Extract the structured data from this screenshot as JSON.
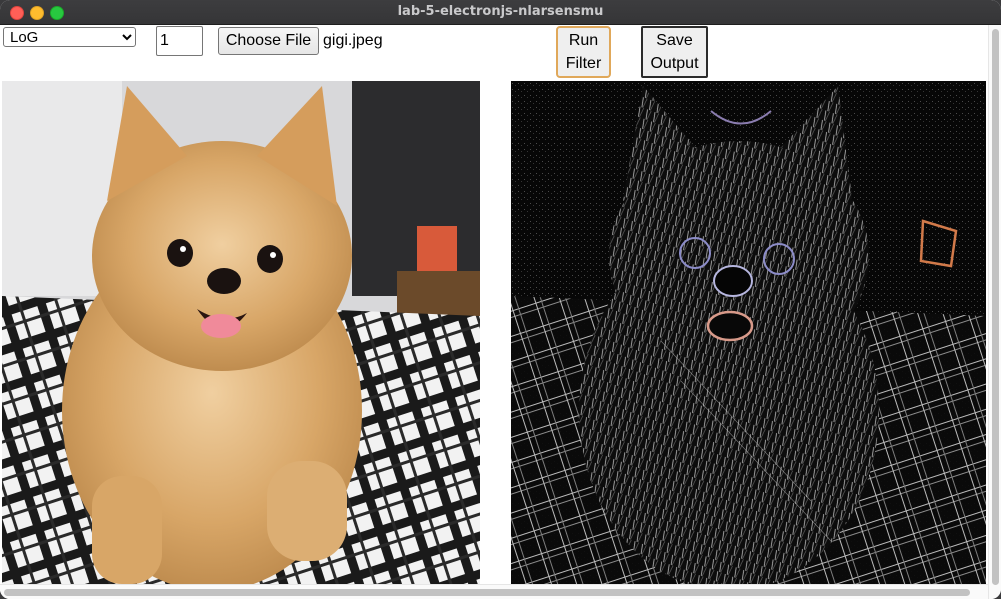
{
  "window": {
    "title": "lab-5-electronjs-nlarsensmu"
  },
  "controls": {
    "filter_selected": "LoG",
    "filter_options": [
      "LoG"
    ],
    "size_value": "1",
    "choose_file_label": "Choose File",
    "file_name": "gigi.jpeg",
    "run_line1": "Run",
    "run_line2": "Filter",
    "save_line1": "Save",
    "save_line2": "Output"
  },
  "images": {
    "input_subject": "pomeranian-dog-photo",
    "output_subject": "log-edge-filtered-dog"
  },
  "colors": {
    "run_border": "#e0a85a",
    "dog_fur": "#d9a86a",
    "blanket": "#1b1b1b"
  }
}
